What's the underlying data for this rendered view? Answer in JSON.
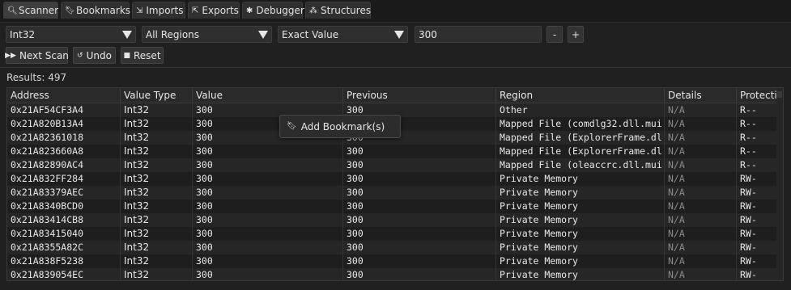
{
  "tabs": [
    {
      "label": "Scanner",
      "icon": "search-icon",
      "glyph": "🔍︎"
    },
    {
      "label": "Bookmarks",
      "icon": "bookmark-icon",
      "glyph": "🔖︎"
    },
    {
      "label": "Imports",
      "icon": "imports-icon",
      "glyph": "⇲"
    },
    {
      "label": "Exports",
      "icon": "exports-icon",
      "glyph": "⇱"
    },
    {
      "label": "Debugger",
      "icon": "bug-icon",
      "glyph": "✱"
    },
    {
      "label": "Structures",
      "icon": "structures-icon",
      "glyph": "⁂"
    }
  ],
  "filters": {
    "value_type": "Int32",
    "region": "All Regions",
    "scan_type": "Exact Value",
    "value": "300"
  },
  "buttons": {
    "minus": "-",
    "plus": "+",
    "next_scan": "Next Scan",
    "undo": "Undo",
    "reset": "Reset",
    "next_glyph": "▶▶",
    "undo_glyph": "↺",
    "reset_glyph": "■"
  },
  "results_label": "Results: 497",
  "columns": [
    "Address",
    "Value Type",
    "Value",
    "Previous",
    "Region",
    "Details",
    "Protecti..."
  ],
  "rows": [
    [
      "0x21AF54CF3A4",
      "Int32",
      "300",
      "300",
      "Other",
      "N/A",
      "R--"
    ],
    [
      "0x21A820B13A4",
      "Int32",
      "300",
      "300",
      "Mapped File (comdlg32.dll.mui",
      "N/A",
      "R--"
    ],
    [
      "0x21A82361018",
      "Int32",
      "300",
      "300",
      "Mapped File (ExplorerFrame.dl",
      "N/A",
      "R--"
    ],
    [
      "0x21A823660A8",
      "Int32",
      "300",
      "300",
      "Mapped File (ExplorerFrame.dl",
      "N/A",
      "R--"
    ],
    [
      "0x21A82890AC4",
      "Int32",
      "300",
      "300",
      "Mapped File (oleaccrc.dll.mui",
      "N/A",
      "R--"
    ],
    [
      "0x21A832FF284",
      "Int32",
      "300",
      "300",
      "Private Memory",
      "N/A",
      "RW-"
    ],
    [
      "0x21A83379AEC",
      "Int32",
      "300",
      "300",
      "Private Memory",
      "N/A",
      "RW-"
    ],
    [
      "0x21A8340BCD0",
      "Int32",
      "300",
      "300",
      "Private Memory",
      "N/A",
      "RW-"
    ],
    [
      "0x21A83414CB8",
      "Int32",
      "300",
      "300",
      "Private Memory",
      "N/A",
      "RW-"
    ],
    [
      "0x21A83415040",
      "Int32",
      "300",
      "300",
      "Private Memory",
      "N/A",
      "RW-"
    ],
    [
      "0x21A8355A82C",
      "Int32",
      "300",
      "300",
      "Private Memory",
      "N/A",
      "RW-"
    ],
    [
      "0x21A838F5238",
      "Int32",
      "300",
      "300",
      "Private Memory",
      "N/A",
      "RW-"
    ],
    [
      "0x21A839054EC",
      "Int32",
      "300",
      "300",
      "Private Memory",
      "N/A",
      "RW-"
    ]
  ],
  "context_menu": {
    "item": "Add Bookmark(s)",
    "icon": "bookmark-icon",
    "glyph": "🔖︎"
  }
}
